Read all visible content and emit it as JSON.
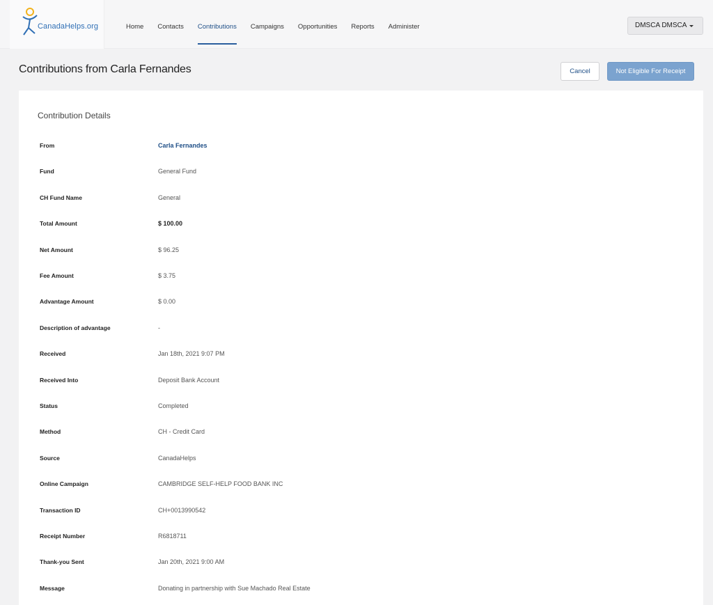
{
  "brand": {
    "logo_text": "CanadaHelps.org",
    "accent": "#2a5e9e"
  },
  "nav": {
    "items": [
      {
        "label": "Home"
      },
      {
        "label": "Contacts"
      },
      {
        "label": "Contributions",
        "active": true
      },
      {
        "label": "Campaigns"
      },
      {
        "label": "Opportunities"
      },
      {
        "label": "Reports"
      },
      {
        "label": "Administer"
      }
    ]
  },
  "user_menu": {
    "label": "DMSCA DMSCA",
    "icon": "chevron-down-icon"
  },
  "header": {
    "title": "Contributions from Carla Fernandes",
    "cancel_label": "Cancel",
    "primary_label": "Not Eligible For Receipt"
  },
  "details": {
    "title": "Contribution Details",
    "rows": [
      {
        "label": "From",
        "value": "Carla Fernandes"
      },
      {
        "label": "Fund",
        "value": "General Fund"
      },
      {
        "label": "CH Fund Name",
        "value": "General"
      },
      {
        "label": "Total Amount",
        "value": "$ 100.00"
      },
      {
        "label": "Net Amount",
        "value": "$ 96.25"
      },
      {
        "label": "Fee Amount",
        "value": "$ 3.75"
      },
      {
        "label": "Advantage Amount",
        "value": "$ 0.00"
      },
      {
        "label": "Description of advantage",
        "value": "-"
      },
      {
        "label": "Received",
        "value": "Jan 18th, 2021 9:07 PM"
      },
      {
        "label": "Received Into",
        "value": "Deposit Bank Account"
      },
      {
        "label": "Status",
        "value": "Completed"
      },
      {
        "label": "Method",
        "value": "CH - Credit Card"
      },
      {
        "label": "Source",
        "value": "CanadaHelps"
      },
      {
        "label": "Online Campaign",
        "value": "CAMBRIDGE SELF-HELP FOOD BANK INC"
      },
      {
        "label": "Transaction ID",
        "value": "CH+0013990542"
      },
      {
        "label": "Receipt Number",
        "value": "R6818711"
      },
      {
        "label": "Thank-you Sent",
        "value": "Jan 20th, 2021 9:00 AM"
      },
      {
        "label": "Message",
        "value": "Donating in partnership with Sue Machado Real Estate"
      }
    ]
  }
}
